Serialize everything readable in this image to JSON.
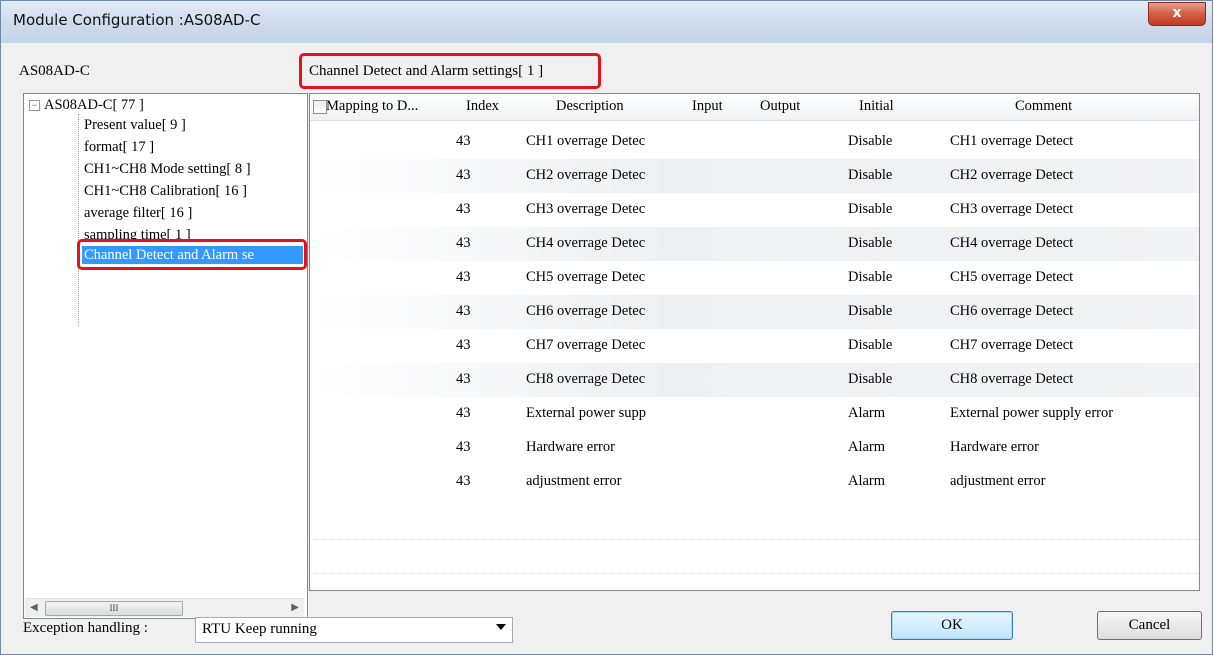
{
  "window": {
    "title": "Module Configuration :AS08AD-C",
    "close_label": "x"
  },
  "tree": {
    "header": "AS08AD-C",
    "root": "AS08AD-C[ 77 ]",
    "collapse_symbol": "−",
    "items": [
      {
        "label": "Present value[ 9 ]"
      },
      {
        "label": "format[ 17 ]"
      },
      {
        "label": "CH1~CH8 Mode setting[ 8 ]"
      },
      {
        "label": "CH1~CH8 Calibration[ 16 ]"
      },
      {
        "label": "average filter[ 16 ]"
      },
      {
        "label": "sampling time[ 1 ]"
      },
      {
        "label": "Channel Detect and Alarm se"
      }
    ],
    "scroll_thumb": "III"
  },
  "grid": {
    "title": "Channel Detect and Alarm settings[ 1 ]",
    "columns": {
      "mapping": "Mapping to D...",
      "index": "Index",
      "description": "Description",
      "input": "Input",
      "output": "Output",
      "initial": "Initial",
      "comment": "Comment"
    },
    "rows": [
      {
        "index": "43",
        "description": "CH1 overrage Detec",
        "initial": "Disable",
        "comment": "CH1 overrage Detect"
      },
      {
        "index": "43",
        "description": "CH2 overrage Detec",
        "initial": "Disable",
        "comment": "CH2 overrage Detect"
      },
      {
        "index": "43",
        "description": "CH3 overrage Detec",
        "initial": "Disable",
        "comment": "CH3 overrage Detect"
      },
      {
        "index": "43",
        "description": "CH4 overrage Detec",
        "initial": "Disable",
        "comment": "CH4 overrage Detect"
      },
      {
        "index": "43",
        "description": "CH5 overrage Detec",
        "initial": "Disable",
        "comment": "CH5 overrage Detect"
      },
      {
        "index": "43",
        "description": "CH6 overrage Detec",
        "initial": "Disable",
        "comment": "CH6 overrage Detect"
      },
      {
        "index": "43",
        "description": "CH7 overrage Detec",
        "initial": "Disable",
        "comment": "CH7 overrage Detect"
      },
      {
        "index": "43",
        "description": "CH8 overrage Detec",
        "initial": "Disable",
        "comment": "CH8 overrage Detect"
      },
      {
        "index": "43",
        "description": "External power supp",
        "initial": "Alarm",
        "comment": "External power supply error"
      },
      {
        "index": "43",
        "description": "Hardware error",
        "initial": "Alarm",
        "comment": "Hardware error"
      },
      {
        "index": "43",
        "description": "adjustment error",
        "initial": "Alarm",
        "comment": "adjustment error"
      }
    ]
  },
  "footer": {
    "exception_label": "Exception handling :",
    "exception_value": "RTU Keep running",
    "ok_label": "OK",
    "cancel_label": "Cancel"
  },
  "colors": {
    "highlight": "#e0141e",
    "selection": "#3399ff"
  }
}
